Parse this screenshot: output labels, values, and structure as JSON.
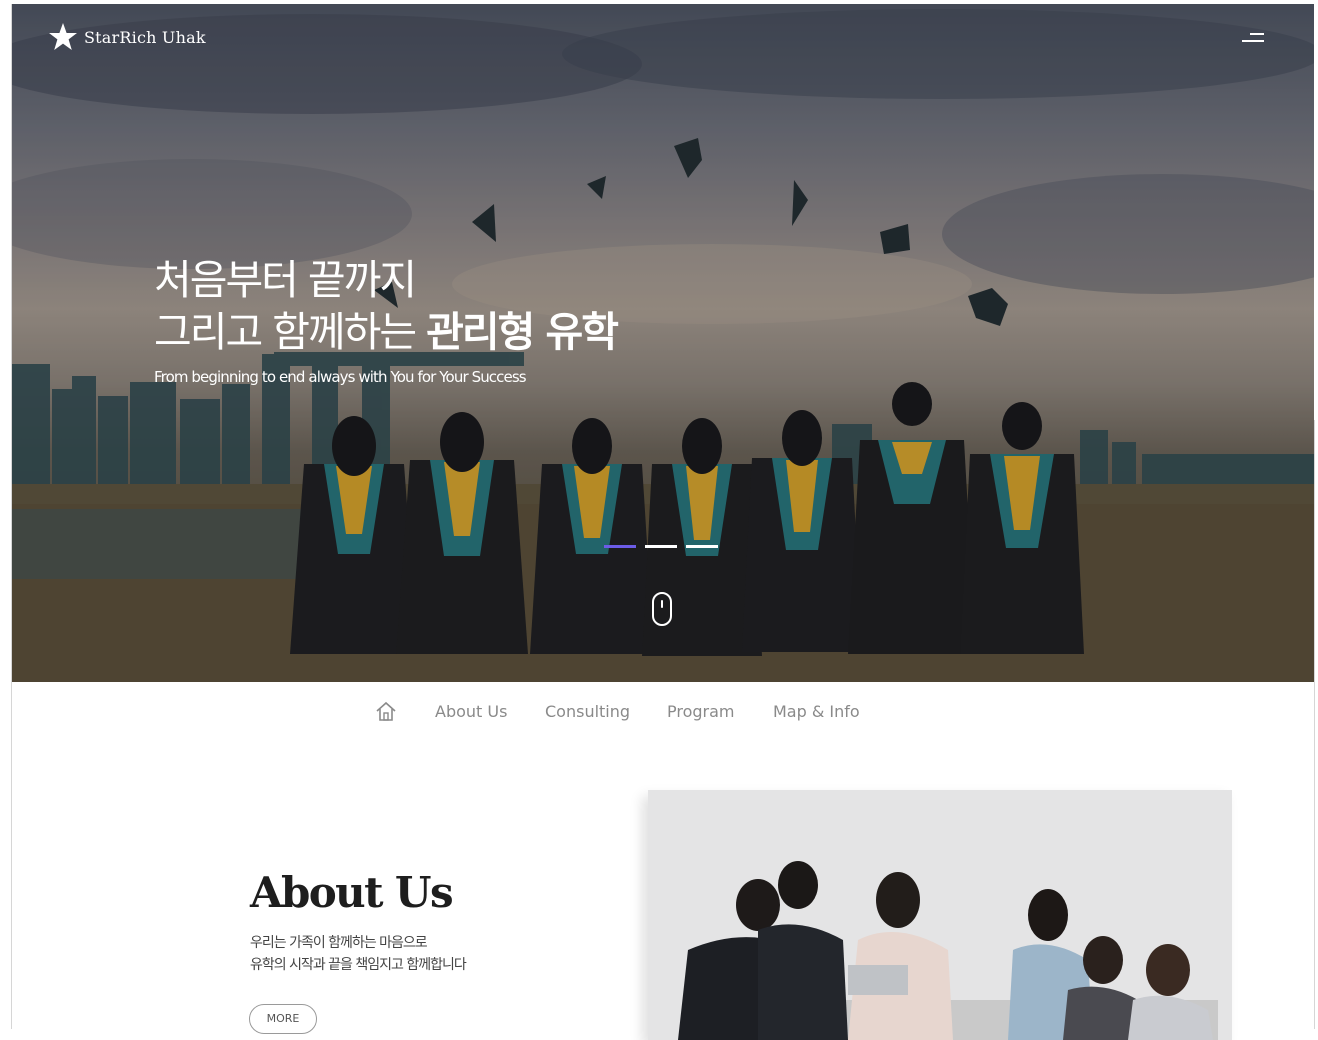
{
  "header": {
    "logo_text": "StarRich Uhak",
    "menu_icon": "hamburger-menu-icon"
  },
  "hero": {
    "headline_line1": "처음부터 끝까지",
    "headline_line2_light": "그리고 함께하는",
    "headline_line2_bold": "관리형 유학",
    "subtitle": "From beginning to end always with You for Your Success",
    "slide_count": 3,
    "active_slide": 1,
    "scroll_icon": "mouse-scroll-icon",
    "accent_color": "#6c5ce7"
  },
  "subnav": {
    "home_icon": "home-icon",
    "items": [
      {
        "label": "About Us"
      },
      {
        "label": "Consulting"
      },
      {
        "label": "Program"
      },
      {
        "label": "Map & Info"
      }
    ]
  },
  "about": {
    "title": "About Us",
    "desc_line1": "우리는 가족이 함께하는 마음으로",
    "desc_line2": "유학의 시작과 끝을 책임지고 함께합니다",
    "more_label": "MORE"
  }
}
